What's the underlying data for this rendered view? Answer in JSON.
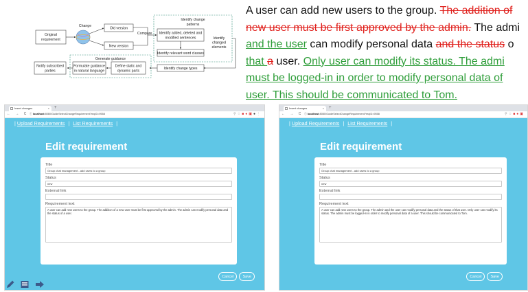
{
  "diagram": {
    "original_requirement": [
      "Original",
      "requirement"
    ],
    "change": "Change",
    "old_version": "Old version",
    "new_version": "New version",
    "compare": "Compare",
    "identify_patterns": [
      "Identify change",
      "patterns"
    ],
    "identify_sentences": [
      "Identify added, deleted and",
      "modified sentences"
    ],
    "identify_changed": [
      "Identify",
      "changed",
      "elements"
    ],
    "identify_words": "Identify relevant word classes",
    "identify_types": "Identify change types",
    "generate_guidance": "Generate guidance",
    "formulate": [
      "Formulate guidance",
      "in natural language"
    ],
    "define": [
      "Define static and",
      "dynamic parts"
    ],
    "notify": [
      "Notify subscribed",
      "parties"
    ]
  },
  "annotation_lines": [
    [
      {
        "t": " A user can add new users to the group. ",
        "s": "plain"
      },
      {
        "t": "The addition of",
        "s": "del"
      }
    ],
    [
      {
        "t": "new user must be first approved by the admin.",
        "s": "del"
      },
      {
        "t": " The admi",
        "s": "plain"
      }
    ],
    [
      {
        "t": "and the user",
        "s": "add"
      },
      {
        "t": " can modify personal data ",
        "s": "plain"
      },
      {
        "t": "and the status",
        "s": "del"
      },
      {
        "t": " o",
        "s": "plain"
      }
    ],
    [
      {
        "t": "that ",
        "s": "add"
      },
      {
        "t": "a",
        "s": "del"
      },
      {
        "t": " user. ",
        "s": "plain"
      },
      {
        "t": "Only user can modify its status. The admi",
        "s": "add"
      }
    ],
    [
      {
        "t": "must be logged-in in order to modify personal data of",
        "s": "add"
      }
    ],
    [
      {
        "t": "user. This should be communicated to Tom.",
        "s": "add"
      }
    ]
  ],
  "browser": {
    "tab_title": "Insert changes",
    "tab_close": "×",
    "new_tab": "+",
    "nav_icons": "← → C",
    "url_host": "localhost",
    "url_path": ":8080/GuideSelectChangeRequirement?reqID=9558",
    "colors": {
      "app_background": "#5fc6e6",
      "deleted": "#e0201c",
      "added": "#2f9e3a"
    }
  },
  "app": {
    "nav_sep": "|",
    "nav_upload": "Upload Requirements",
    "nav_list": "List Requirements",
    "page_title": "Edit requirement",
    "title_label": "Title",
    "title_value": "Group chat management - add users to a group",
    "status_label": "Status",
    "status_value": "new",
    "external_label": "External link",
    "external_value": "",
    "req_label": "Requirement text",
    "cancel": "Cancel",
    "save": "Save"
  },
  "left": {
    "requirement_text": "A user can add new users to the group. The addition of a new user must be first approved by the admin. The admin can modify personal data and the status of a user."
  },
  "right": {
    "requirement_text": "A user can add new users to the group.  The admin and the user can modify personal data and the status of that user. Only user can modify its status. The admin must be logged-in in order to modify personal data of a user. This should be communicated to Tom."
  },
  "toolbar": {
    "icons": [
      "pencil-icon",
      "layout-icon",
      "arrow-right-icon"
    ]
  }
}
